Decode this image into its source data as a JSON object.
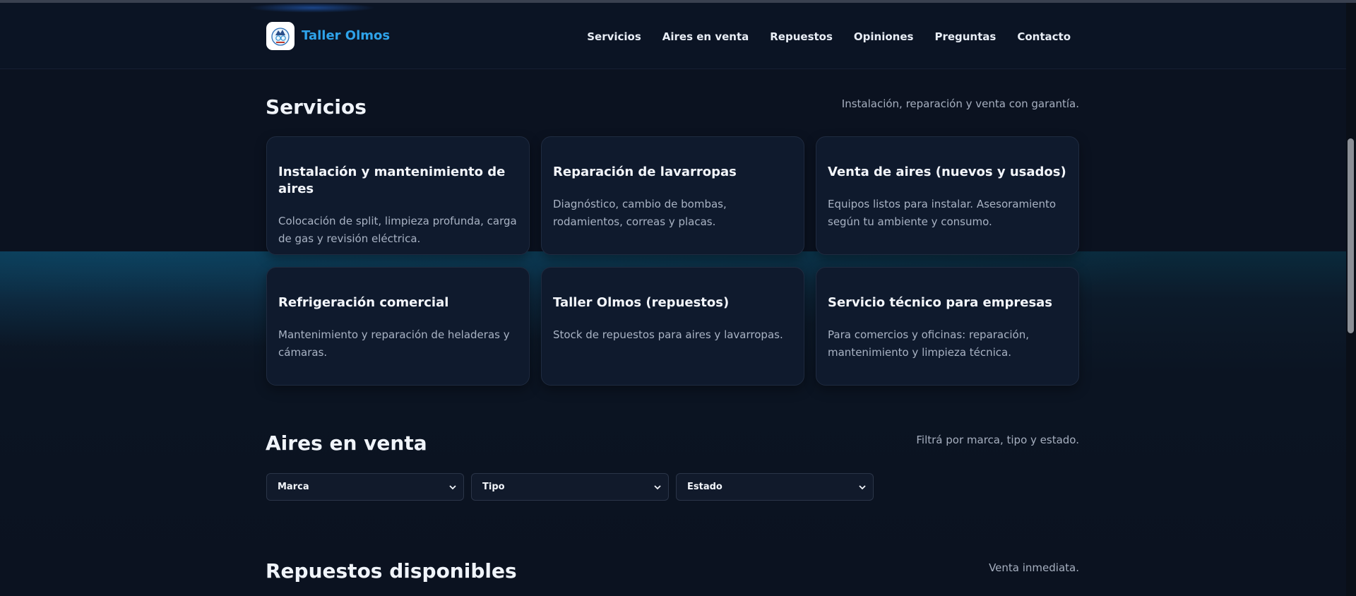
{
  "brand": {
    "name": "Taller Olmos",
    "color": "#2ea3ea",
    "logo_icon": "taller-olmos-logo"
  },
  "nav": [
    {
      "label": "Servicios"
    },
    {
      "label": "Aires en venta"
    },
    {
      "label": "Repuestos"
    },
    {
      "label": "Opiniones"
    },
    {
      "label": "Preguntas"
    },
    {
      "label": "Contacto"
    }
  ],
  "servicios": {
    "title": "Servicios",
    "subtitle": "Instalación, reparación y venta con garantía.",
    "cards": [
      {
        "title": "Instalación y mantenimiento de aires",
        "desc": "Colocación de split, limpieza profunda, carga de gas y revisión eléctrica."
      },
      {
        "title": "Reparación de lavarropas",
        "desc": "Diagnóstico, cambio de bombas, rodamientos, correas y placas."
      },
      {
        "title": "Venta de aires (nuevos y usados)",
        "desc": "Equipos listos para instalar. Asesoramiento según tu ambiente y consumo."
      },
      {
        "title": "Refrigeración comercial",
        "desc": "Mantenimiento y reparación de heladeras y cámaras."
      },
      {
        "title": "Taller Olmos (repuestos)",
        "desc": "Stock de repuestos para aires y lavarropas."
      },
      {
        "title": "Servicio técnico para empresas",
        "desc": "Para comercios y oficinas: reparación, mantenimiento y limpieza técnica."
      }
    ]
  },
  "aires": {
    "title": "Aires en venta",
    "subtitle": "Filtrá por marca, tipo y estado.",
    "filters": [
      {
        "selected": "Marca"
      },
      {
        "selected": "Tipo"
      },
      {
        "selected": "Estado"
      }
    ]
  },
  "repuestos": {
    "title": "Repuestos disponibles",
    "subtitle": "Venta inmediata."
  },
  "colors": {
    "background": "#0b1220",
    "card": "#0f1a2d",
    "accent": "#2ea3ea"
  }
}
